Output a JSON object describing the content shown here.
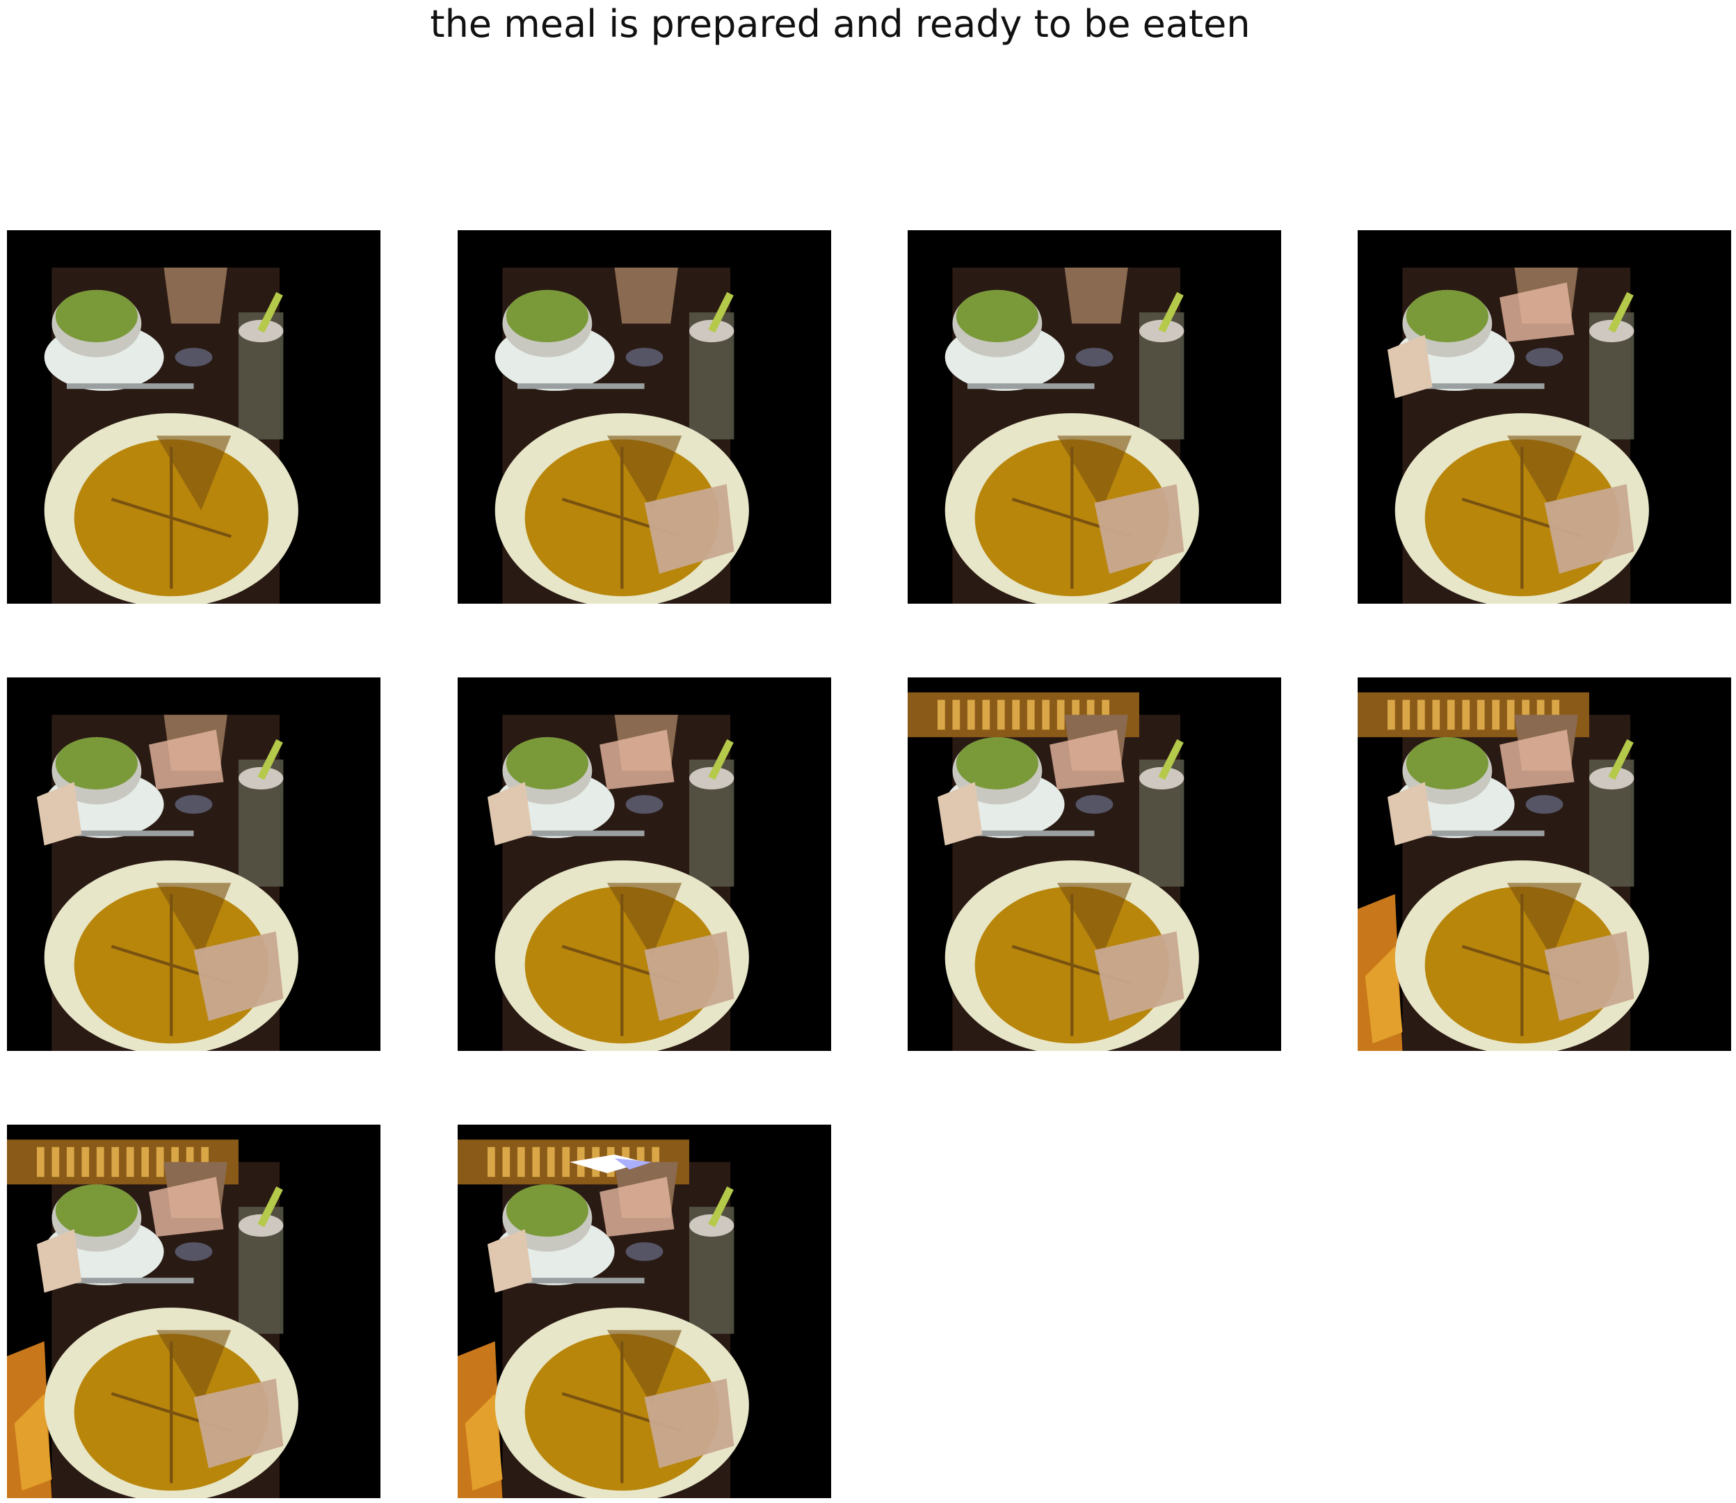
{
  "title": "the meal is prepared and ready to be eaten",
  "frames": [
    {
      "id": 1,
      "sandwich_overlay": false,
      "salad_overlay": false,
      "top_strip": false,
      "left_strip": false,
      "glitch": false
    },
    {
      "id": 2,
      "sandwich_overlay": true,
      "salad_overlay": false,
      "top_strip": false,
      "left_strip": false,
      "glitch": false
    },
    {
      "id": 3,
      "sandwich_overlay": true,
      "salad_overlay": false,
      "top_strip": false,
      "left_strip": false,
      "glitch": false
    },
    {
      "id": 4,
      "sandwich_overlay": true,
      "salad_overlay": true,
      "top_strip": false,
      "left_strip": false,
      "glitch": false
    },
    {
      "id": 5,
      "sandwich_overlay": true,
      "salad_overlay": true,
      "top_strip": false,
      "left_strip": false,
      "glitch": false
    },
    {
      "id": 6,
      "sandwich_overlay": true,
      "salad_overlay": true,
      "top_strip": false,
      "left_strip": false,
      "glitch": false
    },
    {
      "id": 7,
      "sandwich_overlay": true,
      "salad_overlay": true,
      "top_strip": true,
      "left_strip": false,
      "glitch": false
    },
    {
      "id": 8,
      "sandwich_overlay": true,
      "salad_overlay": true,
      "top_strip": true,
      "left_strip": true,
      "glitch": false
    },
    {
      "id": 9,
      "sandwich_overlay": true,
      "salad_overlay": true,
      "top_strip": true,
      "left_strip": true,
      "glitch": false
    },
    {
      "id": 10,
      "sandwich_overlay": true,
      "salad_overlay": true,
      "top_strip": true,
      "left_strip": true,
      "glitch": true
    }
  ],
  "colors": {
    "table": "#2a1a14",
    "plate": "#e8e6c8",
    "omelette": "#b8860b",
    "omelette_dark": "#7a5210",
    "salad": "#7a9a3a",
    "drink": "#8a6a50",
    "milkshake": "#cfc8c0",
    "straw": "#b5c94a",
    "sandwich": "#c8a890",
    "strip": "#8a5a18"
  }
}
